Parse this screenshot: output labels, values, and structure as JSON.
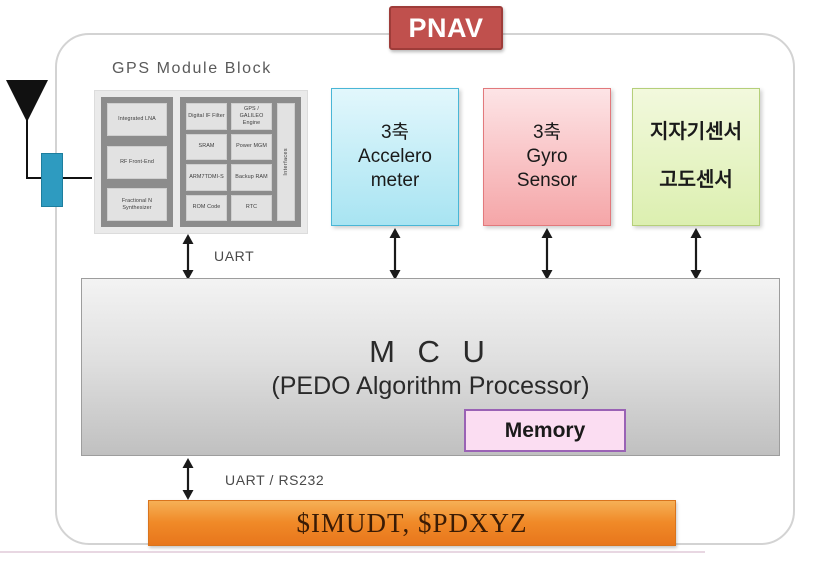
{
  "title": {
    "label": "PNAV",
    "color": "#c0504d"
  },
  "antenna": {
    "icon": "antenna-triangle-icon",
    "connector_color": "#2e9bc0"
  },
  "gps_module": {
    "label": "GPS Module Block",
    "left_panel": [
      {
        "label": "Integrated LNA"
      },
      {
        "label": "RF Front-End"
      },
      {
        "label": "Fractional\nN Synthesizer"
      }
    ],
    "grid": [
      {
        "label": "Digital IF Filter"
      },
      {
        "label": "GPS / GALILEO Engine"
      },
      {
        "label": "SRAM"
      },
      {
        "label": "Power MGM"
      },
      {
        "label": "ARM7TDMI-S"
      },
      {
        "label": "Backup RAM"
      },
      {
        "label": "ROM Code"
      },
      {
        "label": "RTC"
      }
    ],
    "interfaces_label": "Interfaces"
  },
  "sensors": [
    {
      "id": "accelerometer",
      "line1": "3축",
      "line2": "Accelero",
      "line3": "meter",
      "color": "#a8e4f2"
    },
    {
      "id": "gyro",
      "line1": "3축",
      "line2": "Gyro",
      "line3": "Sensor",
      "color": "#f5a6a8"
    },
    {
      "id": "magnetometer-altimeter",
      "line1": "지자기센서",
      "line2": "고도센서",
      "color": "#dcefb0"
    }
  ],
  "connections": {
    "gps_to_mcu": "UART",
    "mcu_to_output": "UART / RS232"
  },
  "mcu": {
    "title": "M  C  U",
    "subtitle": "(PEDO Algorithm Processor)",
    "memory_label": "Memory",
    "memory_color": "#fbddf2"
  },
  "output": {
    "label": "$IMUDT,  $PDXYZ",
    "color": "#f08a28"
  }
}
